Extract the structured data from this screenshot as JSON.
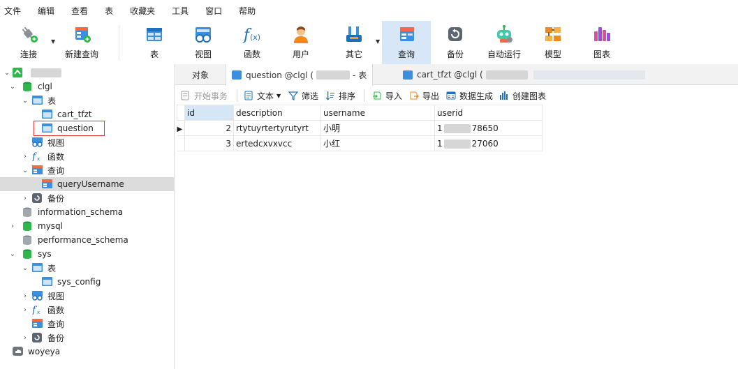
{
  "menu": [
    "文件",
    "编辑",
    "查看",
    "表",
    "收藏夹",
    "工具",
    "窗口",
    "帮助"
  ],
  "toolbar": {
    "connect": "连接",
    "new_query": "新建查询",
    "table": "表",
    "view": "视图",
    "function": "函数",
    "user": "用户",
    "other": "其它",
    "query": "查询",
    "backup": "备份",
    "auto_run": "自动运行",
    "model": "模型",
    "chart": "图表"
  },
  "tree": {
    "db_clgl": "clgl",
    "tables": "表",
    "cart_tfzt": "cart_tfzt",
    "question": "question",
    "views": "视图",
    "functions": "函数",
    "queries": "查询",
    "query_username": "queryUsername",
    "backup": "备份",
    "information_schema": "information_schema",
    "mysql": "mysql",
    "performance_schema": "performance_schema",
    "sys": "sys",
    "sys_tables": "表",
    "sys_config": "sys_config",
    "sys_views": "视图",
    "sys_functions": "函数",
    "sys_queries": "查询",
    "sys_backup": "备份",
    "woyeya": "woyeya"
  },
  "tabs": {
    "objects": "对象",
    "question_prefix": "question @clgl (",
    "question_suffix": "- 表",
    "cart_prefix": "cart_tfzt @clgl ("
  },
  "subtoolbar": {
    "begin_tx": "开始事务",
    "text": "文本",
    "filter": "筛选",
    "sort": "排序",
    "import": "导入",
    "export": "导出",
    "data_gen": "数据生成",
    "create_chart": "创建图表"
  },
  "grid": {
    "columns": [
      "id",
      "description",
      "username",
      "userid"
    ],
    "rows": [
      {
        "id": "2",
        "description": "rtytuyrtertyrutyrt",
        "username": "小明",
        "userid_a": "1",
        "userid_b": "78650"
      },
      {
        "id": "3",
        "description": "ertedcxvxvcc",
        "username": "小红",
        "userid_a": "1",
        "userid_b": "27060"
      }
    ]
  }
}
